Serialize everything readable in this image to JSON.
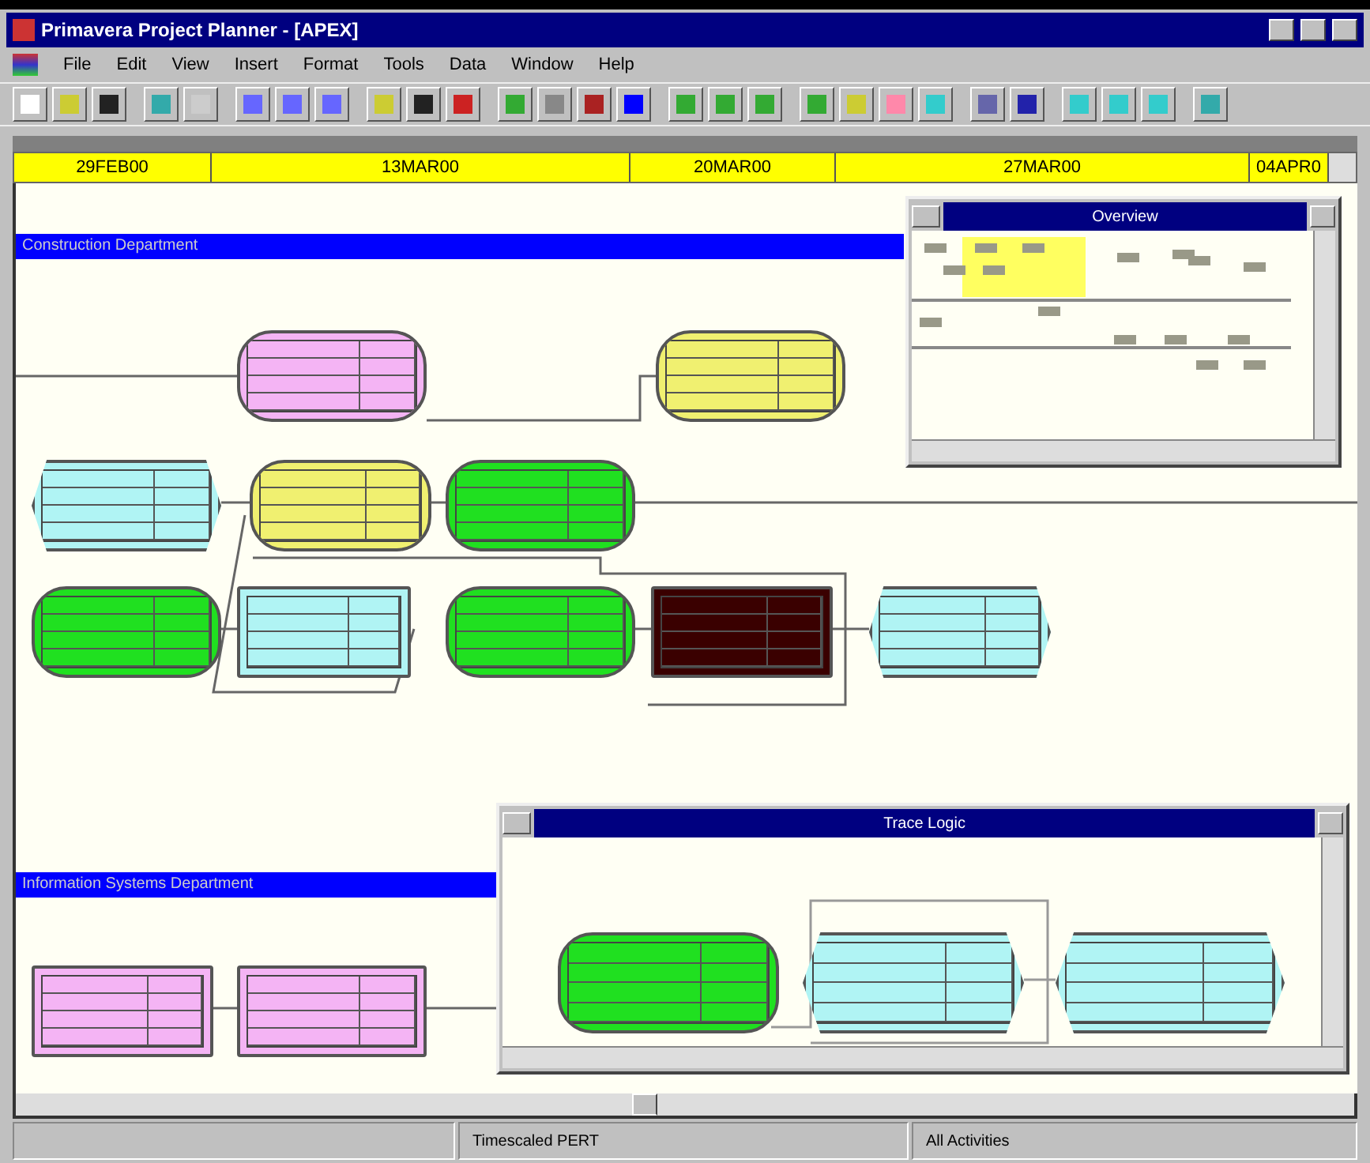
{
  "window": {
    "title": "Primavera Project Planner - [APEX]"
  },
  "menu": [
    "File",
    "Edit",
    "View",
    "Insert",
    "Format",
    "Tools",
    "Data",
    "Window",
    "Help"
  ],
  "timescale": [
    "29FEB00",
    "13MAR00",
    "20MAR00",
    "27MAR00",
    "04APR0"
  ],
  "departments": [
    {
      "name": "Construction Department"
    },
    {
      "name": "Information Systems Department"
    }
  ],
  "activities": [
    {
      "kind": "round",
      "color": "#f4b4f4"
    },
    {
      "kind": "round",
      "color": "#f0f070"
    },
    {
      "kind": "hex",
      "color": "#b0f4f4"
    },
    {
      "kind": "round",
      "color": "#f0f070"
    },
    {
      "kind": "round",
      "color": "#20e020"
    },
    {
      "kind": "round",
      "color": "#20e020"
    },
    {
      "kind": "rect",
      "color": "#b0f4f4"
    },
    {
      "kind": "round",
      "color": "#20e020"
    },
    {
      "kind": "rect",
      "color": "#3a0000"
    },
    {
      "kind": "hex",
      "color": "#b0f4f4"
    },
    {
      "kind": "rect",
      "color": "#f4b4f4"
    },
    {
      "kind": "rect",
      "color": "#f4b4f4"
    }
  ],
  "overview": {
    "title": "Overview"
  },
  "trace_logic": {
    "title": "Trace Logic",
    "activities": [
      {
        "kind": "round",
        "color": "#20e020"
      },
      {
        "kind": "hex",
        "color": "#b0f4f4"
      },
      {
        "kind": "hex",
        "color": "#b0f4f4"
      }
    ]
  },
  "status_bar": [
    "Timescaled PERT",
    "All Activities"
  ]
}
